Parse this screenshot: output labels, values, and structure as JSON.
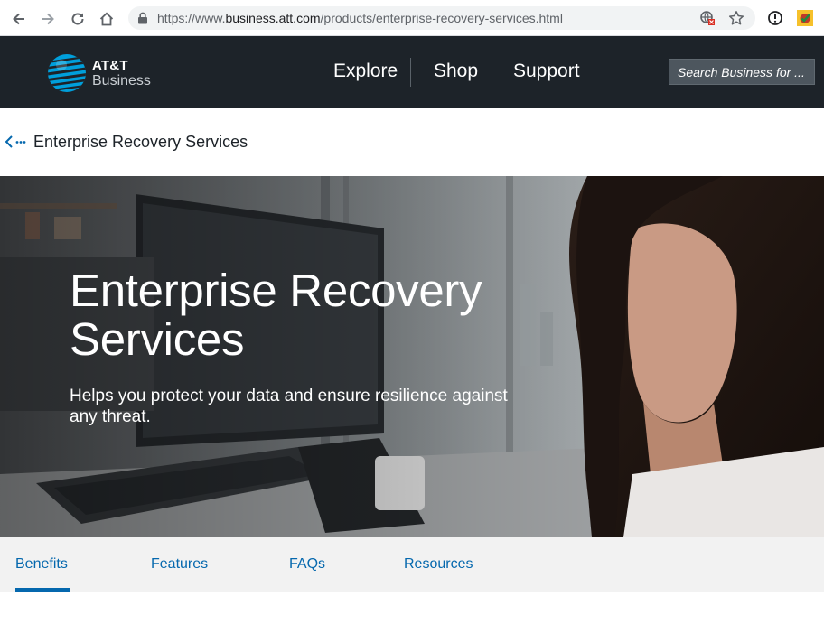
{
  "browser": {
    "url_prefix": "https://www.",
    "url_domain": "business.att.com",
    "url_path": "/products/enterprise-recovery-services.html"
  },
  "header": {
    "logo_line1": "AT&T",
    "logo_line2": "Business",
    "nav": [
      "Explore",
      "Shop",
      "Support"
    ],
    "search_placeholder": "Search Business for ..."
  },
  "breadcrumb": {
    "title": "Enterprise Recovery Services"
  },
  "hero": {
    "title_line1": "Enterprise Recovery",
    "title_line2": "Services",
    "subtitle": "Helps you protect your data and ensure resilience against any threat."
  },
  "tabs": [
    "Benefits",
    "Features",
    "FAQs",
    "Resources"
  ],
  "active_tab": "Benefits",
  "colors": {
    "header_bg": "#1d2329",
    "brand_blue": "#009fdb",
    "link_blue": "#0568ae",
    "tab_bar_bg": "#f2f2f2"
  },
  "icons": [
    "back-arrow-icon",
    "forward-arrow-icon",
    "reload-icon",
    "home-icon",
    "lock-icon",
    "translate-icon",
    "star-icon",
    "extension-info-icon",
    "extension-check-icon",
    "att-globe-logo",
    "breadcrumb-back-icon"
  ]
}
